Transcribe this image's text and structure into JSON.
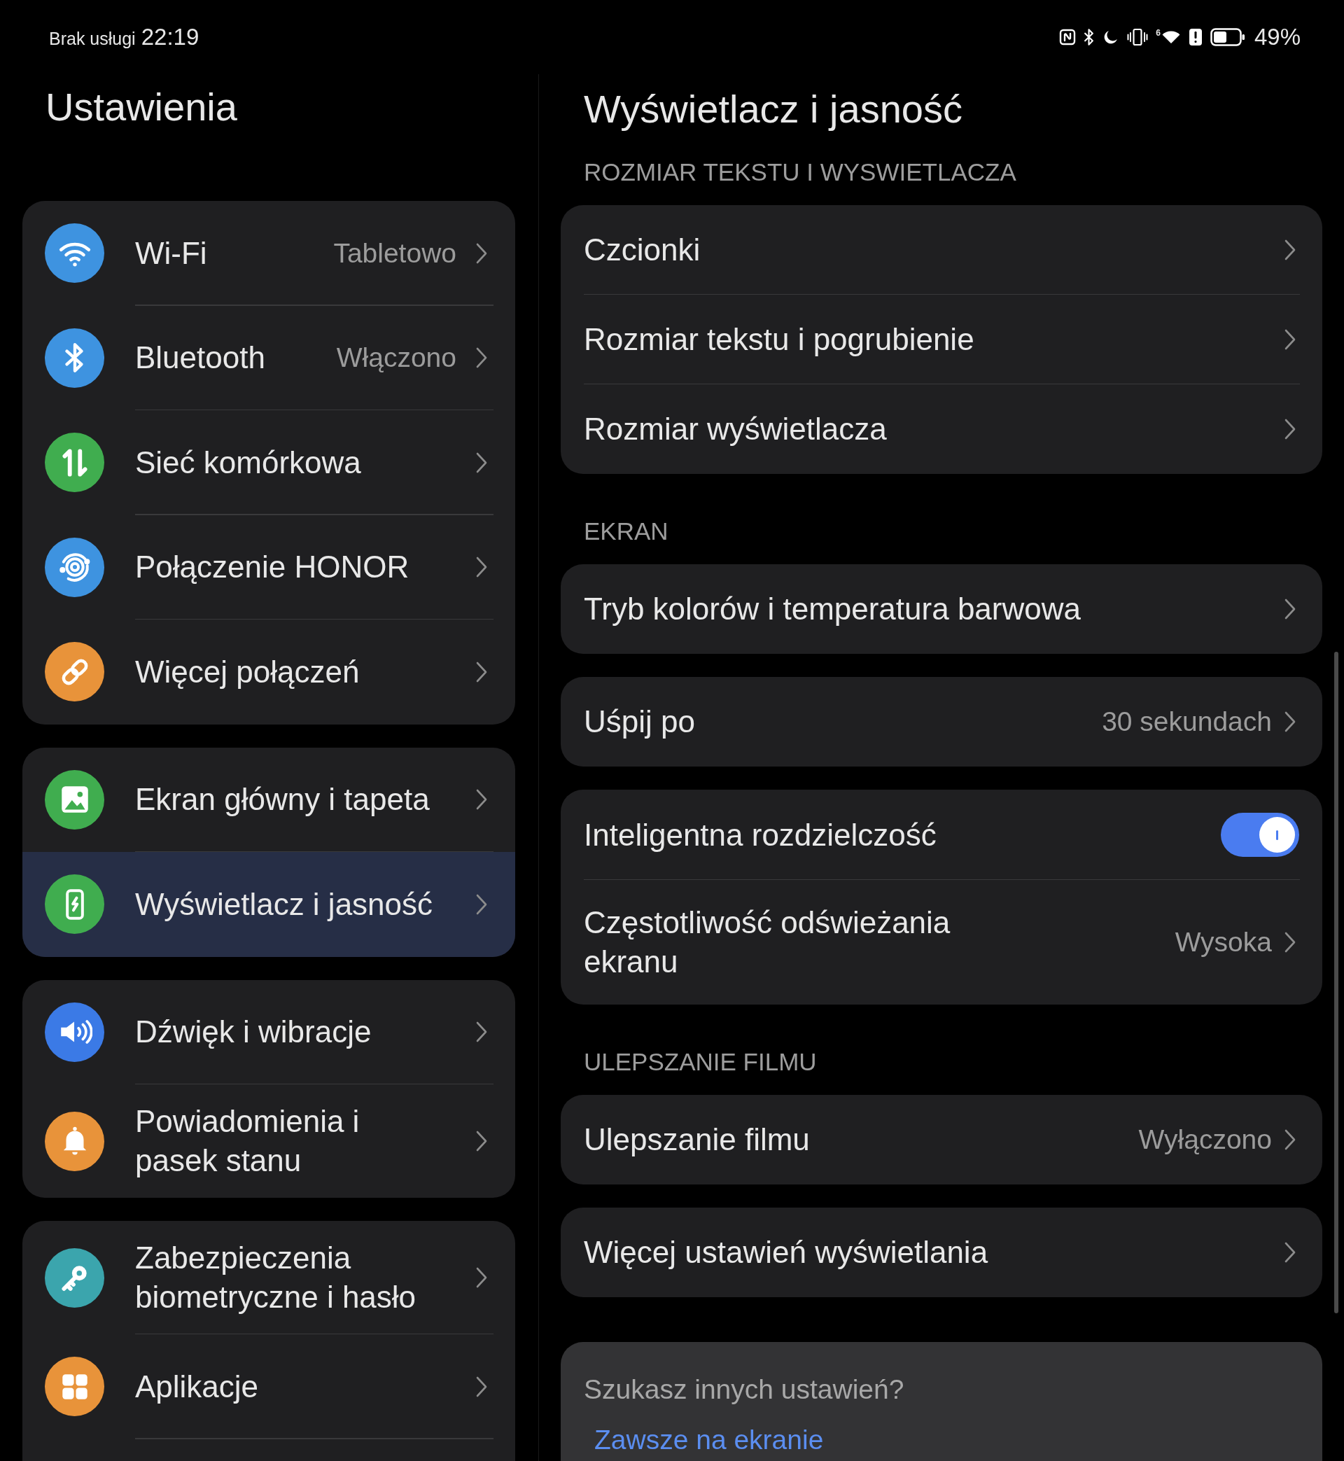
{
  "status_bar": {
    "carrier": "Brak usługi",
    "time": "22:19",
    "wifi_label": "6",
    "battery": "49%"
  },
  "sidebar": {
    "title": "Ustawienia",
    "groups": [
      {
        "items": [
          {
            "label": "Wi-Fi",
            "value": "Tabletowo",
            "color": "#3e93e0",
            "selected": false
          },
          {
            "label": "Bluetooth",
            "value": "Włączono",
            "color": "#3e93e0",
            "selected": false
          },
          {
            "label": "Sieć komórkowa",
            "color": "#40ad4f",
            "selected": false
          },
          {
            "label": "Połączenie HONOR",
            "color": "#3e93e0",
            "selected": false
          },
          {
            "label": "Więcej połączeń",
            "color": "#e8933a",
            "selected": false
          }
        ]
      },
      {
        "items": [
          {
            "label": "Ekran główny i tapeta",
            "color": "#40ad4f",
            "selected": false
          },
          {
            "label": "Wyświetlacz i jasność",
            "color": "#40ad4f",
            "selected": true
          }
        ]
      },
      {
        "items": [
          {
            "label": "Dźwięk i wibracje",
            "color": "#3b7ae6",
            "selected": false
          },
          {
            "label": "Powiadomienia i pasek stanu",
            "color": "#e8933a",
            "selected": false
          }
        ]
      },
      {
        "items": [
          {
            "label": "Zabezpieczenia biometryczne i hasło",
            "color": "#3ba5ad",
            "selected": false
          },
          {
            "label": "Aplikacje",
            "color": "#e8933a",
            "selected": false
          }
        ]
      }
    ]
  },
  "detail": {
    "title": "Wyświetlacz i jasność",
    "sections": [
      {
        "header": "ROZMIAR TEKSTU I WYSWIETLACZA",
        "cards": [
          {
            "rows": [
              {
                "kind": "link",
                "label": "Czcionki"
              },
              {
                "kind": "link",
                "label": "Rozmiar tekstu i pogrubienie"
              },
              {
                "kind": "link",
                "label": "Rozmiar wyświetlacza"
              }
            ]
          }
        ]
      },
      {
        "header": "EKRAN",
        "cards": [
          {
            "rows": [
              {
                "kind": "link",
                "label": "Tryb kolorów i temperatura barwowa"
              }
            ]
          },
          {
            "rows": [
              {
                "kind": "link",
                "label": "Uśpij po",
                "value": "30 sekundach"
              }
            ]
          },
          {
            "rows": [
              {
                "kind": "toggle",
                "label": "Inteligentna rozdzielczość",
                "on": true
              },
              {
                "kind": "link",
                "label": "Częstotliwość odświeżania ekranu",
                "value": "Wysoka"
              }
            ]
          }
        ]
      },
      {
        "header": "ULEPSZANIE FILMU",
        "cards": [
          {
            "rows": [
              {
                "kind": "link",
                "label": "Ulepszanie filmu",
                "value": "Wyłączono"
              }
            ]
          },
          {
            "rows": [
              {
                "kind": "link",
                "label": "Więcej ustawień wyświetlania"
              }
            ]
          }
        ]
      }
    ],
    "suggestions": {
      "title": "Szukasz innych ustawień?",
      "links": [
        "Zawsze na ekranie"
      ]
    }
  }
}
